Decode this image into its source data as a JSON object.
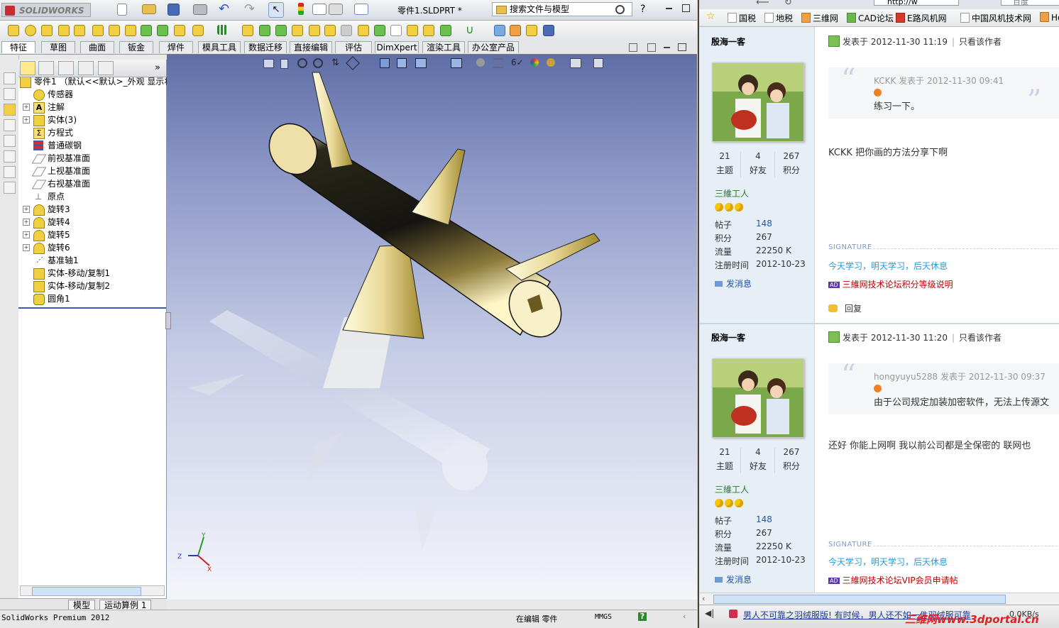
{
  "solidworks": {
    "logo": "SOLIDWORKS",
    "doc_title": "零件1.SLDPRT *",
    "search_placeholder": "搜索文件与模型",
    "help_icon": "?",
    "tabs": [
      "特征",
      "草图",
      "曲面",
      "钣金",
      "焊件",
      "模具工具",
      "数据迁移",
      "直接编辑",
      "评估",
      "DimXpert",
      "渲染工具",
      "办公室产品"
    ],
    "active_tab": "特征",
    "tree": {
      "root": "零件1 （默认<<默认>_外观 显示状",
      "items": [
        {
          "label": "传感器",
          "expand": ""
        },
        {
          "label": "注解",
          "expand": "+"
        },
        {
          "label": "实体(3)",
          "expand": "+"
        },
        {
          "label": "方程式",
          "expand": ""
        },
        {
          "label": "普通碳钢",
          "expand": ""
        },
        {
          "label": "前视基准面",
          "expand": ""
        },
        {
          "label": "上视基准面",
          "expand": ""
        },
        {
          "label": "右视基准面",
          "expand": ""
        },
        {
          "label": "原点",
          "expand": ""
        },
        {
          "label": "旋转3",
          "expand": "+"
        },
        {
          "label": "旋转4",
          "expand": "+"
        },
        {
          "label": "旋转5",
          "expand": "+"
        },
        {
          "label": "旋转6",
          "expand": "+"
        },
        {
          "label": "基准轴1",
          "expand": ""
        },
        {
          "label": "实体-移动/复制1",
          "expand": ""
        },
        {
          "label": "实体-移动/复制2",
          "expand": ""
        },
        {
          "label": "圆角1",
          "expand": ""
        }
      ]
    },
    "bottom_tabs": [
      "模型",
      "运动算例 1"
    ],
    "status": {
      "app": "SolidWorks Premium 2012",
      "editing": "在编辑 零件",
      "units": "MMGS",
      "help": "?"
    },
    "triad": {
      "x": "X",
      "y": "Y",
      "z": "Z"
    }
  },
  "browser": {
    "address": "http://w",
    "search_placeholder": "百度",
    "favorites": [
      {
        "label": "国税",
        "icon": "page"
      },
      {
        "label": "地税",
        "icon": "page"
      },
      {
        "label": "三维网",
        "icon": "orange"
      },
      {
        "label": "CAD论坛",
        "icon": "green"
      },
      {
        "label": "E路风机网",
        "icon": "red"
      },
      {
        "label": "中国风机技术网",
        "icon": "page"
      },
      {
        "label": "Ho",
        "icon": "orange"
      }
    ],
    "posts": [
      {
        "author": "殷海一客",
        "stats": [
          {
            "num": "21",
            "label": "主题"
          },
          {
            "num": "4",
            "label": "好友"
          },
          {
            "num": "267",
            "label": "积分"
          }
        ],
        "group": "三維工人",
        "info": [
          {
            "k": "帖子",
            "v": "148"
          },
          {
            "k": "积分",
            "v": "267"
          },
          {
            "k": "流量",
            "v": "22250 K"
          },
          {
            "k": "注册时间",
            "v": "2012-10-23"
          }
        ],
        "message": "发消息",
        "posted": "发表于 2012-11-30 11:19",
        "only_author": "只看该作者",
        "quote_author": "KCKK 发表于 2012-11-30 09:41",
        "quote_text": "练习一下。",
        "body": "KCKK   把你画的方法分享下啊",
        "sig_title": "SIGNATURE",
        "signature": "今天学习，明天学习，后天休息",
        "ad_badge": "AD",
        "ad": "三維网技术论坛积分等级说明",
        "reply": "回复"
      },
      {
        "author": "殷海一客",
        "stats": [
          {
            "num": "21",
            "label": "主题"
          },
          {
            "num": "4",
            "label": "好友"
          },
          {
            "num": "267",
            "label": "积分"
          }
        ],
        "group": "三維工人",
        "info": [
          {
            "k": "帖子",
            "v": "148"
          },
          {
            "k": "积分",
            "v": "267"
          },
          {
            "k": "流量",
            "v": "22250 K"
          },
          {
            "k": "注册时间",
            "v": "2012-10-23"
          }
        ],
        "message": "发消息",
        "posted": "发表于 2012-11-30 11:20",
        "only_author": "只看该作者",
        "quote_author": "hongyuyu5288 发表于 2012-11-30 09:37",
        "quote_text": "由于公司规定加装加密软件，无法上传源文",
        "body": "还好  你能上网啊    我以前公司都是全保密的  联网也",
        "sig_title": "SIGNATURE",
        "signature": "今天学习，明天学习，后天休息",
        "ad_badge": "AD",
        "ad": "三維网技术论坛VIP会员申请帖"
      }
    ],
    "status": {
      "news": "男人不可靠之羽绒服版! 有时候，男人还不如一件羽绒服可靠",
      "watermark": "三维网www.3dportal.cn",
      "speed": "0.0KB/s"
    }
  },
  "colors": {
    "part_gold": "#f1e6a8",
    "part_dark": "#1c1a12",
    "viewport_top": "#5f6fa6",
    "viewport_bottom": "#f4f5fb",
    "link_blue": "#2255aa",
    "signature_blue": "#2a9ad8",
    "ad_red": "#c00000"
  }
}
